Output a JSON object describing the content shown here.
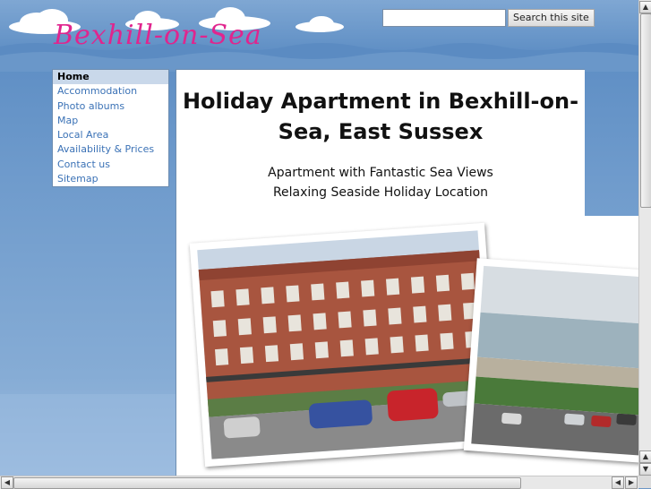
{
  "header": {
    "site_title": "Bexhill-on-Sea",
    "search_placeholder": "",
    "search_button": "Search this site"
  },
  "nav": {
    "items": [
      {
        "label": "Home",
        "active": true
      },
      {
        "label": "Accommodation"
      },
      {
        "label": "Photo albums"
      },
      {
        "label": "Map"
      },
      {
        "label": "Local Area"
      },
      {
        "label": "Availability & Prices"
      },
      {
        "label": "Contact us"
      },
      {
        "label": "Sitemap"
      }
    ]
  },
  "main": {
    "heading": "Holiday Apartment in Bexhill-on-Sea, East Sussex",
    "subheading_1": "Apartment with Fantastic Sea Views",
    "subheading_2": "Relaxing Seaside Holiday Location"
  },
  "colors": {
    "title_pink": "#e0258e",
    "link_blue": "#3b72b6",
    "sky_blue": "#6b96c6"
  }
}
